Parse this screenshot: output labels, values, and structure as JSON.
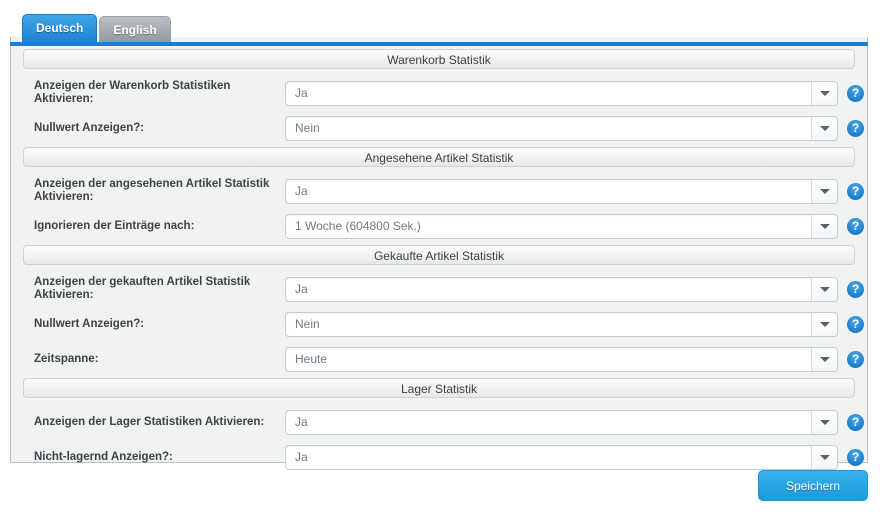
{
  "tabs": [
    {
      "label": "Deutsch",
      "active": true
    },
    {
      "label": "English",
      "active": false
    }
  ],
  "sections": [
    {
      "header": "Warenkorb Statistik",
      "rows": [
        {
          "label": "Anzeigen der Warenkorb Statistiken Aktivieren:",
          "value": "Ja",
          "help": "?"
        },
        {
          "label": "Nullwert Anzeigen?:",
          "value": "Nein",
          "help": "?"
        }
      ]
    },
    {
      "header": "Angesehene Artikel Statistik",
      "rows": [
        {
          "label": "Anzeigen der angesehenen Artikel Statistik Aktivieren:",
          "value": "Ja",
          "help": "?"
        },
        {
          "label": "Ignorieren der Einträge nach:",
          "value": "1 Woche (604800 Sek.)",
          "help": "?"
        }
      ]
    },
    {
      "header": "Gekaufte Artikel Statistik",
      "rows": [
        {
          "label": "Anzeigen der gekauften Artikel Statistik Aktivieren:",
          "value": "Ja",
          "help": "?"
        },
        {
          "label": "Nullwert Anzeigen?:",
          "value": "Nein",
          "help": "?"
        },
        {
          "label": "Zeitspanne:",
          "value": "Heute",
          "help": "?"
        }
      ]
    },
    {
      "header": "Lager Statistik",
      "rows": [
        {
          "label": "Anzeigen der Lager Statistiken Aktivieren:",
          "value": "Ja",
          "help": "?"
        },
        {
          "label": "Nicht-lagernd Anzeigen?:",
          "value": "Ja",
          "help": "?"
        }
      ]
    }
  ],
  "footer": {
    "save_label": "Speichern"
  },
  "colors": {
    "accent_blue": "#1a7fd4",
    "tab_active": "#2f95de",
    "tab_inactive": "#a6aeb4",
    "save_button": "#2aa6e4",
    "help_icon": "#1c7fcd",
    "panel_bg": "#f1f2f2",
    "panel_border": "#b9bfc2",
    "label_text": "#3b4449",
    "value_text": "#6f7b86"
  }
}
